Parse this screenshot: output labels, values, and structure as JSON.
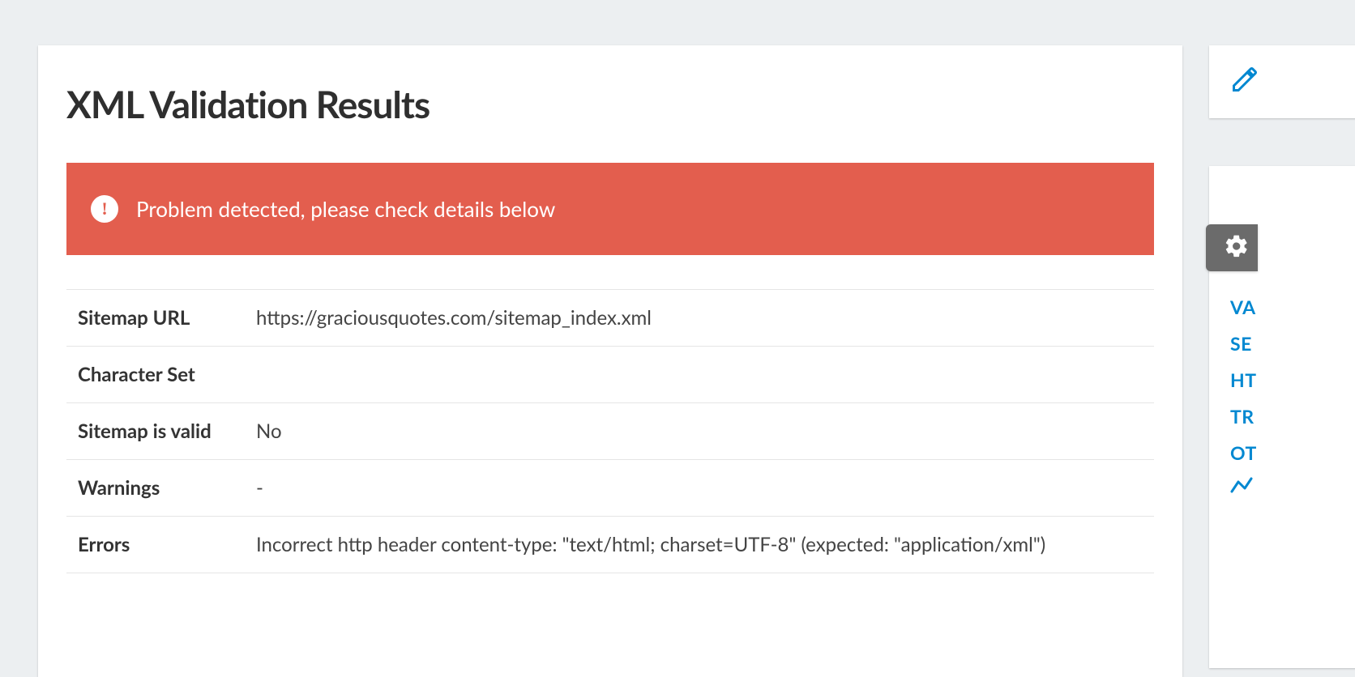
{
  "page": {
    "title": "XML Validation Results"
  },
  "alert": {
    "message": "Problem detected, please check details below"
  },
  "results": {
    "rows": [
      {
        "label": "Sitemap URL",
        "value": "https://graciousquotes.com/sitemap_index.xml"
      },
      {
        "label": "Character Set",
        "value": ""
      },
      {
        "label": "Sitemap is valid",
        "value": "No"
      },
      {
        "label": "Warnings",
        "value": "-"
      },
      {
        "label": "Errors",
        "value": "Incorrect http header content-type: \"text/html; charset=UTF-8\" (expected: \"application/xml\")"
      }
    ]
  },
  "sidebar": {
    "links": [
      "VA",
      "SE",
      "HT",
      "TR",
      "OT"
    ]
  }
}
